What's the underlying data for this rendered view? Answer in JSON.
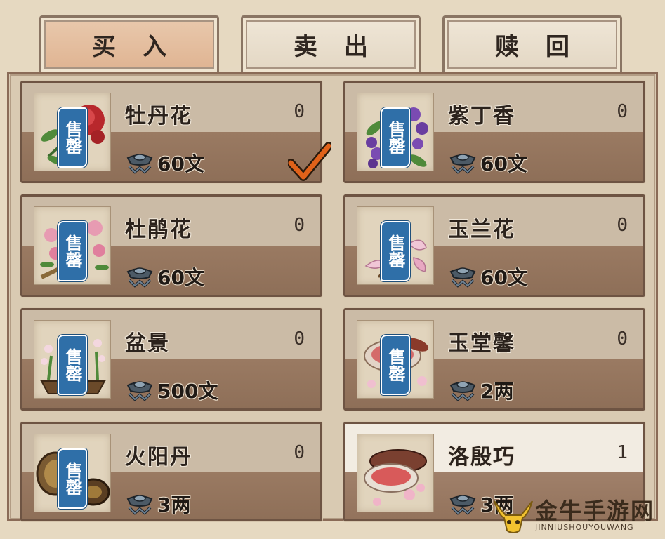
{
  "tabs": [
    {
      "label": "买入",
      "state": "active"
    },
    {
      "label": "卖出",
      "state": "inactive"
    },
    {
      "label": "赎回",
      "state": "inactive"
    }
  ],
  "items": [
    {
      "name": "牡丹花",
      "qty": "0",
      "price": "60文",
      "badge": "售罄",
      "icon": "peony-icon"
    },
    {
      "name": "紫丁香",
      "qty": "0",
      "price": "60文",
      "badge": "售罄",
      "icon": "lilac-icon"
    },
    {
      "name": "杜鹃花",
      "qty": "0",
      "price": "60文",
      "badge": "售罄",
      "icon": "azalea-icon"
    },
    {
      "name": "玉兰花",
      "qty": "0",
      "price": "60文",
      "badge": "售罄",
      "icon": "magnolia-icon"
    },
    {
      "name": "盆景",
      "qty": "0",
      "price": "500文",
      "badge": "售罄",
      "icon": "bonsai-icon"
    },
    {
      "name": "玉堂馨",
      "qty": "0",
      "price": "2两",
      "badge": "售罄",
      "icon": "rouge-icon"
    },
    {
      "name": "火阳丹",
      "qty": "0",
      "price": "3两",
      "badge": "售罄",
      "icon": "compact-icon"
    },
    {
      "name": "洛殷巧",
      "qty": "1",
      "price": "3两",
      "badge": "",
      "icon": "rouge-box-icon"
    }
  ],
  "watermark": {
    "title": "金牛手游网",
    "sub": "JINNIUSHOUYOUWANG"
  },
  "colors": {
    "badge": "#2f6fa8",
    "active_tab": "#dfb391",
    "check": "#e0621a"
  }
}
